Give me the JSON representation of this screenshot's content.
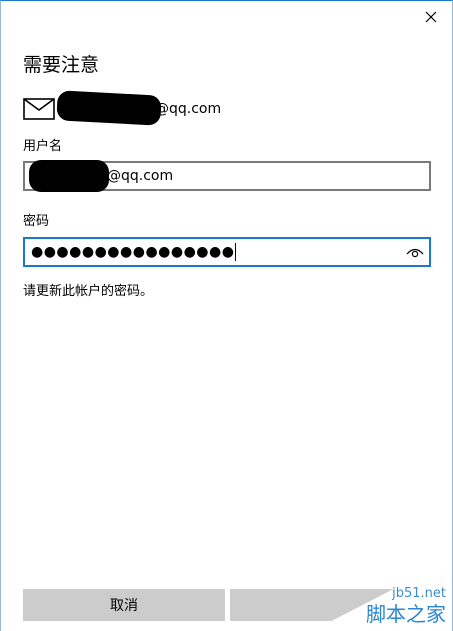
{
  "dialog": {
    "title": "需要注意",
    "account_suffix": "@qq.com",
    "username_label": "用户名",
    "username_value_suffix": "@qq.com",
    "password_label": "密码",
    "password_mask": "●●●●●●●●●●●●●●●●",
    "message": "请更新此帐户的密码。",
    "cancel_label": "取消",
    "done_label": ""
  },
  "icons": {
    "close": "close-icon",
    "mail": "mail-icon",
    "reveal": "eye-icon"
  },
  "watermark": {
    "url": "jb51.net",
    "name": "脚本之家"
  },
  "colors": {
    "accent": "#1979ca",
    "button_bg": "#cccccc",
    "field_border": "#7a7a7a"
  }
}
